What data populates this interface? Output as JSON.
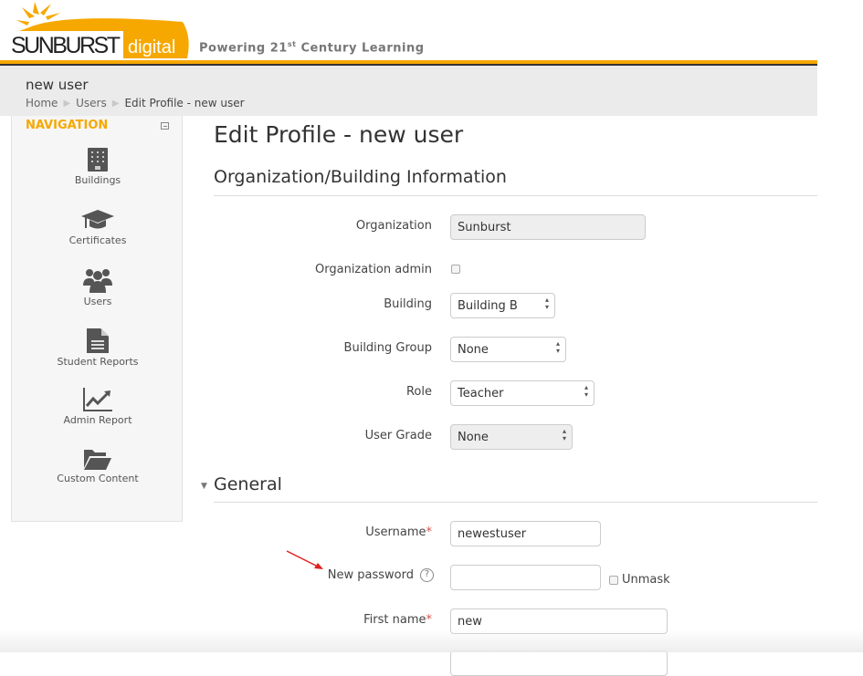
{
  "brand": {
    "logo_text": "SUNBURST",
    "logo_sub": "digital",
    "tagline": "Powering 21",
    "tagline_sup": "st",
    "tagline_end": " Century Learning",
    "accent": "#f6a800"
  },
  "header": {
    "title": "new user",
    "breadcrumbs": [
      "Home",
      "Users",
      "Edit Profile - new user"
    ]
  },
  "nav": {
    "heading": "NAVIGATION",
    "items": [
      {
        "label": "Buildings",
        "icon": "building-icon"
      },
      {
        "label": "Certificates",
        "icon": "graduation-cap-icon"
      },
      {
        "label": "Users",
        "icon": "users-icon"
      },
      {
        "label": "Student Reports",
        "icon": "document-icon"
      },
      {
        "label": "Admin Report",
        "icon": "line-chart-icon"
      },
      {
        "label": "Custom Content",
        "icon": "folder-open-icon"
      }
    ]
  },
  "page": {
    "title": "Edit Profile - new user",
    "org_section": "Organization/Building Information",
    "general_section": "General"
  },
  "form": {
    "organization": {
      "label": "Organization",
      "value": "Sunburst"
    },
    "org_admin": {
      "label": "Organization admin",
      "checked": false
    },
    "building": {
      "label": "Building",
      "value": "Building B"
    },
    "building_group": {
      "label": "Building Group",
      "value": "None"
    },
    "role": {
      "label": "Role",
      "value": "Teacher"
    },
    "user_grade": {
      "label": "User Grade",
      "value": "None"
    },
    "username": {
      "label": "Username",
      "value": "newestuser"
    },
    "password": {
      "label": "New password",
      "value": "",
      "unmask": "Unmask"
    },
    "first_name": {
      "label": "First name",
      "value": "new"
    },
    "required_mark": "*"
  }
}
